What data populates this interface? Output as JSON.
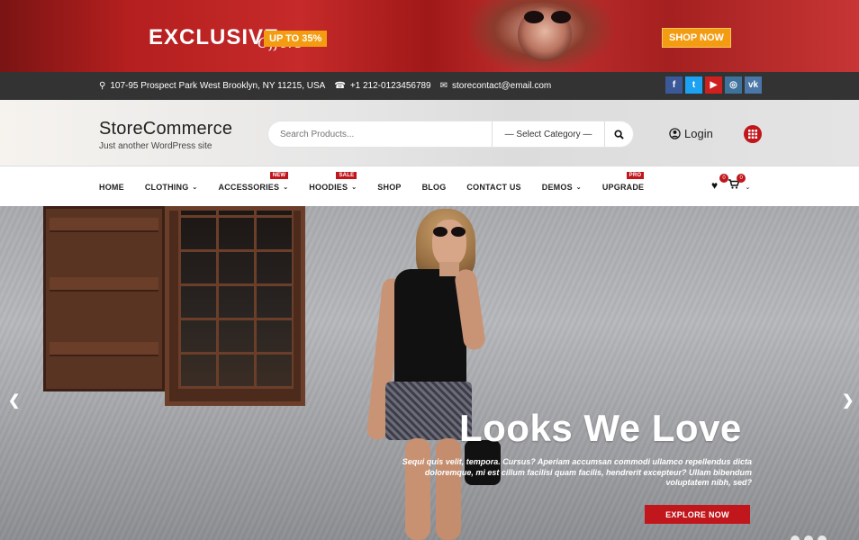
{
  "promo": {
    "title": "EXCLUSIVE",
    "script": "Offers",
    "badge": "UP TO 35%",
    "cta": "SHOP NOW"
  },
  "topbar": {
    "address": "107-95 Prospect Park West Brooklyn, NY 11215, USA",
    "phone": "+1 212-0123456789",
    "email": "storecontact@email.com",
    "socials": [
      {
        "icon": "facebook-icon",
        "glyph": "f",
        "color": "#3b5998"
      },
      {
        "icon": "twitter-icon",
        "glyph": "t",
        "color": "#1da1f2"
      },
      {
        "icon": "youtube-icon",
        "glyph": "▶",
        "color": "#cd201f"
      },
      {
        "icon": "instagram-icon",
        "glyph": "◎",
        "color": "#3f729b"
      },
      {
        "icon": "vk-icon",
        "glyph": "vk",
        "color": "#4a76a8"
      }
    ]
  },
  "header": {
    "site_name": "StoreCommerce",
    "tagline": "Just another WordPress site",
    "search_placeholder": "Search Products...",
    "category_select": "— Select Category —",
    "login_label": "Login"
  },
  "nav": {
    "items": [
      {
        "label": "HOME",
        "chevron": false,
        "badge": ""
      },
      {
        "label": "CLOTHING",
        "chevron": true,
        "badge": ""
      },
      {
        "label": "ACCESSORIES",
        "chevron": true,
        "badge": "NEW"
      },
      {
        "label": "HOODIES",
        "chevron": true,
        "badge": "SALE"
      },
      {
        "label": "SHOP",
        "chevron": false,
        "badge": ""
      },
      {
        "label": "BLOG",
        "chevron": false,
        "badge": ""
      },
      {
        "label": "CONTACT US",
        "chevron": false,
        "badge": ""
      },
      {
        "label": "DEMOS",
        "chevron": true,
        "badge": ""
      },
      {
        "label": "UPGRADE",
        "chevron": false,
        "badge": "PRO"
      }
    ],
    "wishlist_count": "0",
    "cart_count": "0"
  },
  "hero": {
    "title": "Looks We Love",
    "text": "Sequi quis velit, tempora. Cursus? Aperiam accumsan commodi ullamco repellendus dicta doloremque, mi est cillum facilisi quam facilis, hendrerit excepteur? Ullam bibendum voluptatem nibh, sed?",
    "cta": "EXPLORE NOW",
    "prev": "❮",
    "next": "❯"
  },
  "colors": {
    "accent": "#c0161c",
    "promo_orange": "#f39c12",
    "topbar": "#333333"
  }
}
